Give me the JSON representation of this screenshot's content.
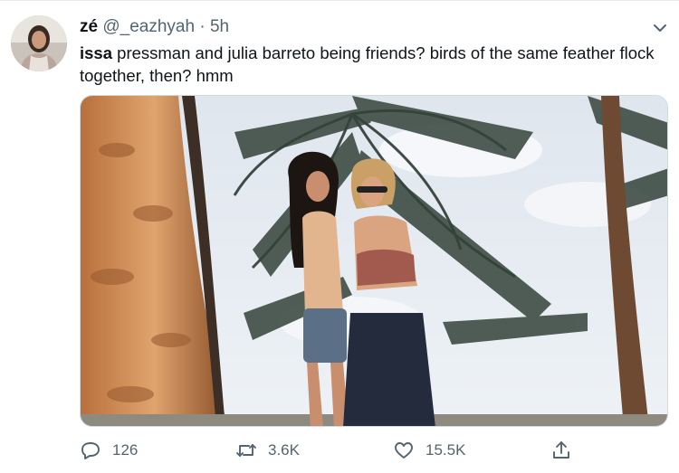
{
  "tweet": {
    "author_name": "zé",
    "author_handle": "@_eazhyah",
    "separator": "·",
    "timestamp": "5h",
    "text_bold": "issa",
    "text_rest": " pressman and julia barreto being friends? birds of the same feather flock together, then? hmm",
    "media_description": "photo",
    "actions": {
      "replies": "126",
      "retweets": "3.6K",
      "likes": "15.5K"
    }
  },
  "colors": {
    "text_primary": "#0f1419",
    "text_secondary": "#536471",
    "border": "#cfd9de"
  },
  "icons": [
    "avatar",
    "chevron-down-icon",
    "reply-icon",
    "retweet-icon",
    "like-icon",
    "share-icon"
  ]
}
